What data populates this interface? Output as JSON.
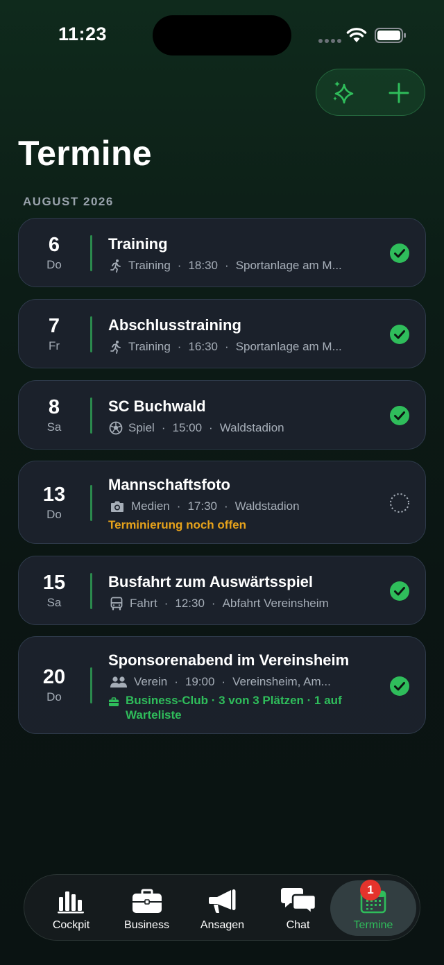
{
  "status_bar": {
    "time": "11:23"
  },
  "colors": {
    "accent": "#2fbd5b",
    "warning": "#e6a21b",
    "badge": "#e5332c",
    "card": "#1c222c"
  },
  "header": {
    "title": "Termine",
    "actions": [
      {
        "icon": "sparkles-icon"
      },
      {
        "icon": "plus-icon"
      }
    ]
  },
  "section": {
    "label": "AUGUST 2026"
  },
  "events": [
    {
      "day": "6",
      "weekday": "Do",
      "title": "Training",
      "meta_icon": "running-icon",
      "category": "Training",
      "time": "18:30",
      "location": "Sportanlage am M...",
      "status": "confirmed"
    },
    {
      "day": "7",
      "weekday": "Fr",
      "title": "Abschlusstraining",
      "meta_icon": "running-icon",
      "category": "Training",
      "time": "16:30",
      "location": "Sportanlage am M...",
      "status": "confirmed"
    },
    {
      "day": "8",
      "weekday": "Sa",
      "title": "SC Buchwald",
      "meta_icon": "soccer-ball-icon",
      "category": "Spiel",
      "time": "15:00",
      "location": "Waldstadion",
      "status": "confirmed"
    },
    {
      "day": "13",
      "weekday": "Do",
      "title": "Mannschaftsfoto",
      "meta_icon": "camera-icon",
      "category": "Medien",
      "time": "17:30",
      "location": "Waldstadion",
      "note": "Terminierung noch offen",
      "status": "pending"
    },
    {
      "day": "15",
      "weekday": "Sa",
      "title": "Busfahrt zum Auswärtsspiel",
      "meta_icon": "bus-icon",
      "category": "Fahrt",
      "time": "12:30",
      "location": "Abfahrt Vereinsheim",
      "status": "confirmed"
    },
    {
      "day": "20",
      "weekday": "Do",
      "title": "Sponsorenabend im Vereinsheim",
      "meta_icon": "people-icon",
      "category": "Verein",
      "time": "19:00",
      "location": "Vereinsheim, Am...",
      "club_info": "Business-Club · 3 von 3 Plätzen · 1 auf Warteliste",
      "status": "confirmed"
    }
  ],
  "tabbar": {
    "tabs": [
      {
        "label": "Cockpit",
        "icon": "bar-chart-icon"
      },
      {
        "label": "Business",
        "icon": "briefcase-icon"
      },
      {
        "label": "Ansagen",
        "icon": "megaphone-icon"
      },
      {
        "label": "Chat",
        "icon": "chat-bubbles-icon"
      },
      {
        "label": "Termine",
        "icon": "calendar-icon",
        "active": true,
        "badge": "1"
      }
    ]
  }
}
